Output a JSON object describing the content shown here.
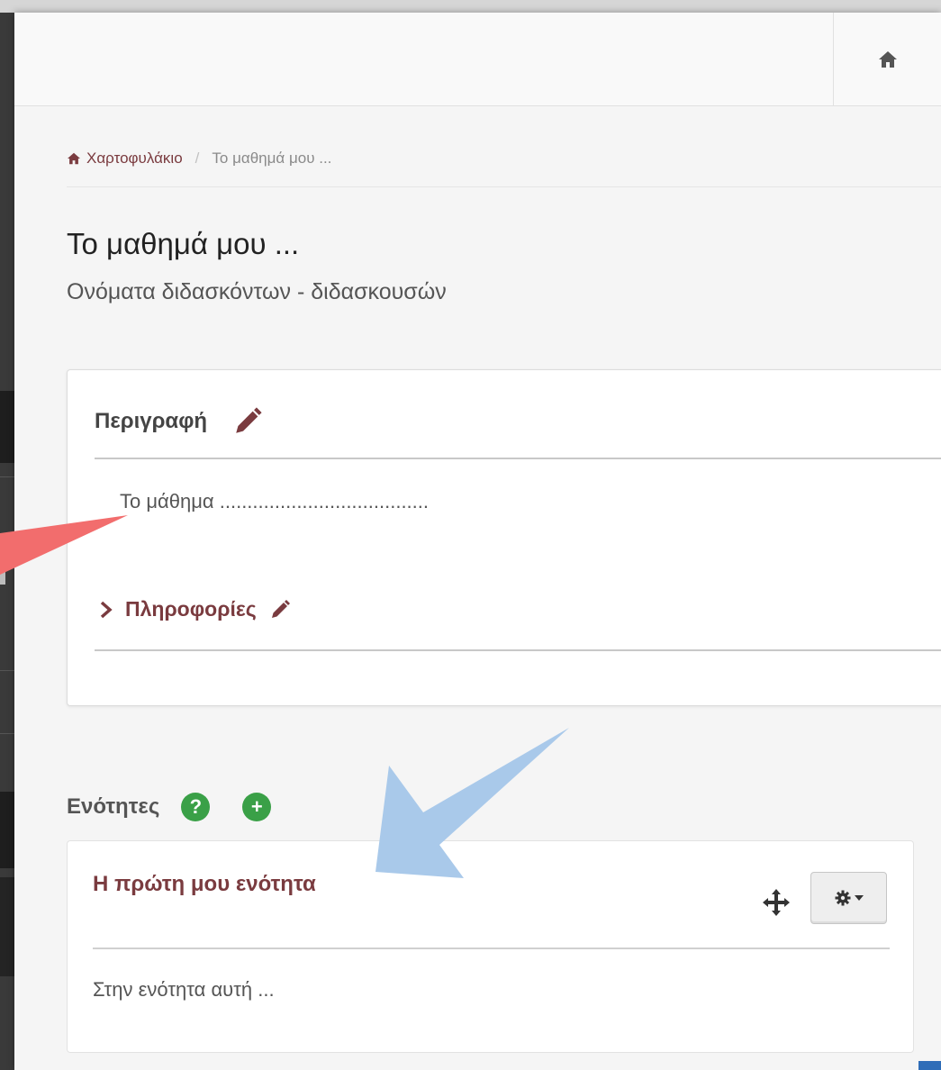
{
  "breadcrumb": {
    "home_label": "Χαρτοφυλάκιο",
    "separator": "/",
    "current": "Το μαθημά μου ..."
  },
  "course": {
    "title": "Το μαθημά μου ...",
    "teachers": "Ονόματα διδασκόντων - διδασκουσών"
  },
  "description": {
    "heading": "Περιγραφή",
    "text": "Το μάθημα ......................................",
    "info_label": "Πληροφορίες"
  },
  "units": {
    "heading": "Ενότητες",
    "help_symbol": "?",
    "add_symbol": "+",
    "items": [
      {
        "title": "Η πρώτη μου ενότητα",
        "text": "Στην ενότητα αυτή ..."
      }
    ]
  },
  "icons": {
    "home": "home-icon",
    "edit": "pencil-icon",
    "expand": "chevron-right-icon",
    "help": "question-circle-icon",
    "add": "plus-circle-icon",
    "move": "move-arrows-icon",
    "settings": "gear-icon",
    "caret": "caret-down-icon"
  },
  "colors": {
    "accent": "#7a3b3f",
    "success": "#3aa047",
    "annotation_red": "#f26d6d",
    "annotation_blue": "#a9c9ea"
  }
}
